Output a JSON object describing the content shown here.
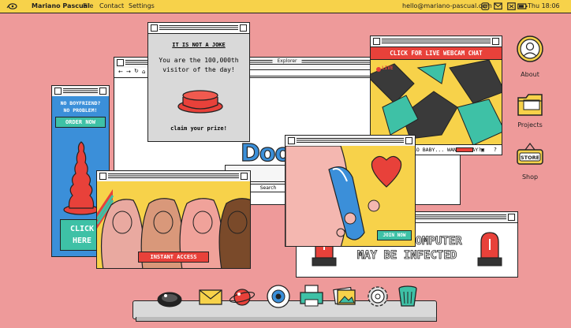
{
  "menubar": {
    "brand": "Mariano Pascual",
    "items": [
      "File",
      "Contact",
      "Settings"
    ],
    "email": "hello@mariano-pascual.com",
    "clock": "Thu 18:06"
  },
  "desktop_icons": [
    {
      "label": "About",
      "icon": "avatar-icon"
    },
    {
      "label": "Projects",
      "icon": "folder-icon"
    },
    {
      "label": "Shop",
      "icon": "store-sign-icon"
    }
  ],
  "explorer": {
    "title": "Explorer",
    "logo_text": "Doo",
    "search_label": "Search"
  },
  "joke_popup": {
    "heading": "IT IS NOT A JOKE",
    "line1": "You are the 100,000th",
    "line2": "visitor of the day!",
    "cta": "claim your prize!"
  },
  "webcam_popup": {
    "banner": "CLICK FOR LIVE WEBCAM CHAT",
    "live_label": "LIVE",
    "caption": "LO BABY... WANNA PLAY?"
  },
  "boyfriend_ad": {
    "line1": "NO BOYFRIEND?",
    "line2": "NO PROBLEM!",
    "button": "ORDER NOW",
    "click1": "CLICK",
    "click2": "HERE"
  },
  "instant_access_ad": {
    "button": "INSTANT ACCESS"
  },
  "join_ad": {
    "button": "JOIN NOW"
  },
  "virus_warning": {
    "line1": "COMPUTER",
    "line2": "MAY BE INFECTED"
  },
  "dock": [
    "bomb-icon",
    "mail-icon",
    "planet-icon",
    "eye-icon",
    "printer-icon",
    "photos-icon",
    "gear-icon",
    "trash-icon"
  ],
  "colors": {
    "background": "#ee9a9a",
    "menubar": "#f7d24a",
    "accent_red": "#e8413a",
    "teal": "#3ec1a6",
    "blue": "#3b8fd9"
  }
}
